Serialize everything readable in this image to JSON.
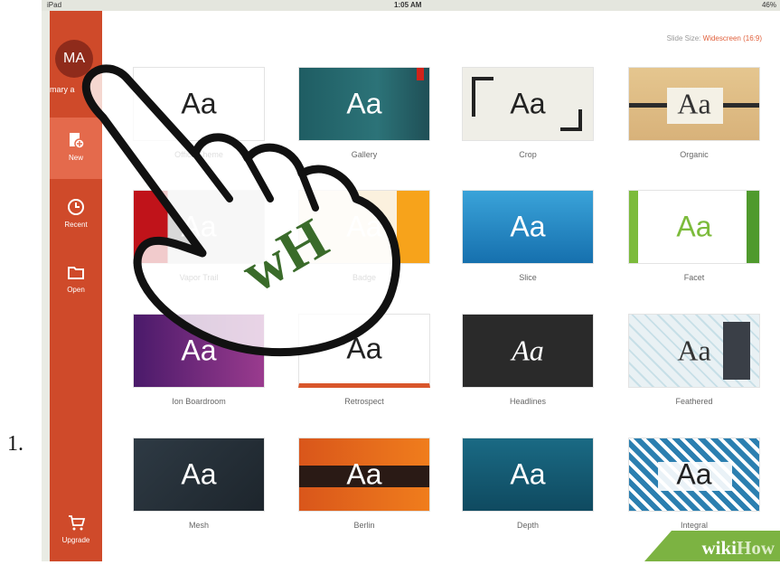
{
  "list_marker": "1.",
  "status_bar": {
    "device": "iPad",
    "time": "1:05 AM",
    "battery": "46%"
  },
  "sidebar": {
    "avatar_initials": "MA",
    "user_name": "mary a",
    "items": [
      {
        "label": "New",
        "icon": "new-document-icon"
      },
      {
        "label": "Recent",
        "icon": "clock-icon"
      },
      {
        "label": "Open",
        "icon": "folder-icon"
      },
      {
        "label": "Upgrade",
        "icon": "cart-icon"
      }
    ]
  },
  "slide_size": {
    "label": "Slide Size:",
    "value": "Widescreen (16:9)"
  },
  "templates": [
    {
      "name": "Office Theme",
      "preview": "Aa"
    },
    {
      "name": "Gallery",
      "preview": "Aa"
    },
    {
      "name": "Crop",
      "preview": "Aa"
    },
    {
      "name": "Organic",
      "preview": "Aa"
    },
    {
      "name": "Vapor Trail",
      "preview": "Aa"
    },
    {
      "name": "Badge",
      "preview": "Aa"
    },
    {
      "name": "Slice",
      "preview": "Aa"
    },
    {
      "name": "Facet",
      "preview": "Aa"
    },
    {
      "name": "Ion Boardroom",
      "preview": "Aa"
    },
    {
      "name": "Retrospect",
      "preview": "Aa"
    },
    {
      "name": "Headlines",
      "preview": "Aa"
    },
    {
      "name": "Feathered",
      "preview": "Aa"
    },
    {
      "name": "Mesh",
      "preview": "Aa"
    },
    {
      "name": "Berlin",
      "preview": "Aa"
    },
    {
      "name": "Depth",
      "preview": "Aa"
    },
    {
      "name": "Integral",
      "preview": "Aa"
    }
  ],
  "watermark": {
    "wiki": "wiki",
    "how": "How"
  },
  "colors": {
    "sidebar": "#cf4a2a",
    "accent": "#e0603c",
    "wikihow_green": "#7cb342"
  }
}
